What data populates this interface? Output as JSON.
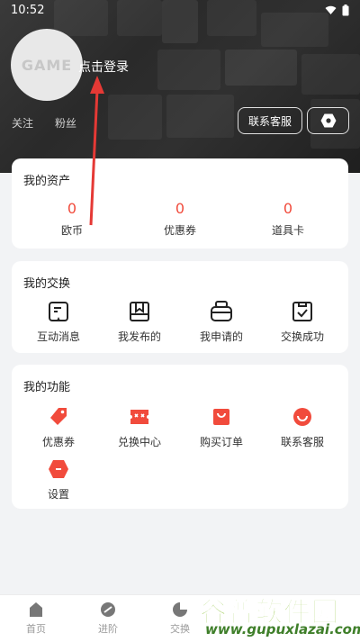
{
  "status_bar": {
    "time": "10:52"
  },
  "profile": {
    "avatar_text": "GAME",
    "login_label": "点击登录",
    "follow_label": "关注",
    "fans_label": "粉丝",
    "service_button": "联系客服",
    "settings_icon": "settings-hexagon-icon"
  },
  "assets": {
    "title": "我的资产",
    "items": [
      {
        "value": "0",
        "label": "欧币"
      },
      {
        "value": "0",
        "label": "优惠券"
      },
      {
        "value": "0",
        "label": "道具卡"
      }
    ]
  },
  "exchange": {
    "title": "我的交换",
    "items": [
      {
        "label": "互动消息",
        "icon": "message-icon"
      },
      {
        "label": "我发布的",
        "icon": "box-icon"
      },
      {
        "label": "我申请的",
        "icon": "request-icon"
      },
      {
        "label": "交换成功",
        "icon": "success-icon"
      }
    ]
  },
  "functions": {
    "title": "我的功能",
    "items": [
      {
        "label": "优惠券",
        "icon": "coupon-tag-icon"
      },
      {
        "label": "兑换中心",
        "icon": "exchange-center-icon"
      },
      {
        "label": "购买订单",
        "icon": "shopping-bag-icon"
      },
      {
        "label": "联系客服",
        "icon": "customer-service-icon"
      },
      {
        "label": "设置",
        "icon": "settings-icon"
      }
    ]
  },
  "tabbar": {
    "items": [
      {
        "label": "首页",
        "icon": "home-icon"
      },
      {
        "label": "进阶",
        "icon": "advance-icon"
      },
      {
        "label": "交换",
        "icon": "exchange-icon"
      }
    ]
  },
  "watermark": {
    "title": "谷普软件园",
    "url": "www.gupuxlazai.com"
  },
  "colors": {
    "accent": "#f14b3c",
    "header_bg": "#2e2e2e",
    "page_bg": "#f2f3f5"
  }
}
